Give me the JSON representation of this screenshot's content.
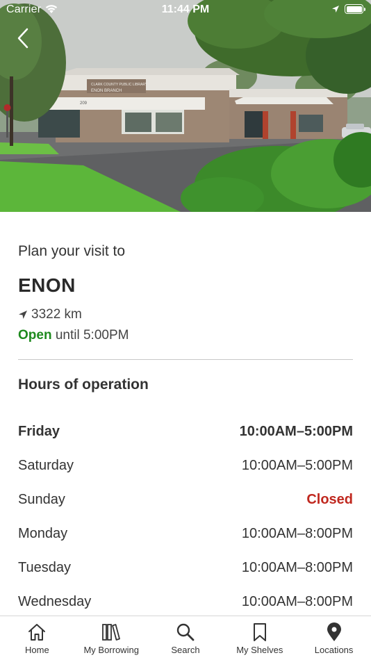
{
  "status_bar": {
    "carrier": "Carrier",
    "time": "11:44 PM"
  },
  "hero": {
    "sign_line1": "CLARK COUNTY PUBLIC LIBRARY",
    "sign_line2": "ENON BRANCH",
    "address_number": "209"
  },
  "visit": {
    "plan_label": "Plan your visit to",
    "branch_name": "ENON",
    "distance": "3322 km",
    "open_status": "Open",
    "open_until": "until 5:00PM"
  },
  "hours": {
    "heading": "Hours of operation",
    "days": [
      {
        "day": "Friday",
        "time": "10:00AM–5:00PM"
      },
      {
        "day": "Saturday",
        "time": "10:00AM–5:00PM"
      },
      {
        "day": "Sunday",
        "time": "Closed"
      },
      {
        "day": "Monday",
        "time": "10:00AM–8:00PM"
      },
      {
        "day": "Tuesday",
        "time": "10:00AM–8:00PM"
      },
      {
        "day": "Wednesday",
        "time": "10:00AM–8:00PM"
      }
    ]
  },
  "colors": {
    "open_green": "#1e8a1e",
    "closed_red": "#c0281f",
    "text": "#333333"
  },
  "tab_bar": {
    "tabs": [
      {
        "label": "Home",
        "icon": "home-icon"
      },
      {
        "label": "My Borrowing",
        "icon": "books-icon"
      },
      {
        "label": "Search",
        "icon": "search-icon"
      },
      {
        "label": "My Shelves",
        "icon": "bookmark-icon"
      },
      {
        "label": "Locations",
        "icon": "map-pin-icon"
      }
    ]
  }
}
